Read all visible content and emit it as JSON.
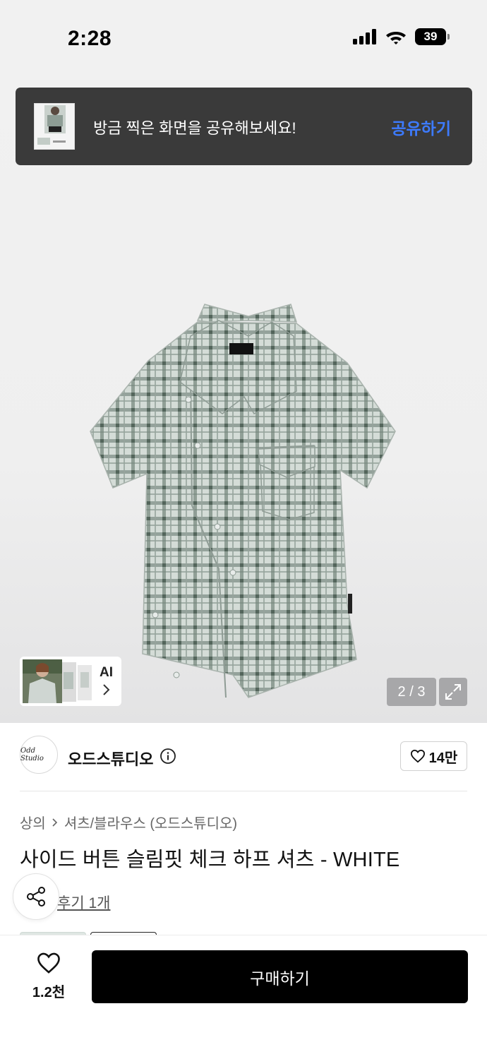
{
  "status_bar": {
    "time": "2:28",
    "battery": "39"
  },
  "share_banner": {
    "text": "방금 찍은 화면을 공유해보세요!",
    "action": "공유하기"
  },
  "gallery": {
    "ai_label": "AI",
    "counter": "2 / 3"
  },
  "brand": {
    "name": "오드스튜디오",
    "logo_text": "Odd Studio",
    "likes": "14만"
  },
  "breadcrumb": {
    "category": "상의",
    "subcategory": "셔츠/블라우스 (오드스튜디오)"
  },
  "product": {
    "title": "사이드 버튼 슬림핏 체크 하프 셔츠 - WHITE",
    "review": "후기 1개"
  },
  "bottom_bar": {
    "wish_count": "1.2천",
    "buy_label": "구매하기"
  },
  "colors": {
    "accent_link": "#3d7bff",
    "buy_button": "#000000",
    "banner_bg": "#3a3a3a"
  },
  "icons": [
    "signal-icon",
    "wifi-icon",
    "battery-icon",
    "chevron-right-icon",
    "expand-icon",
    "info-icon",
    "heart-icon",
    "share-icon"
  ]
}
